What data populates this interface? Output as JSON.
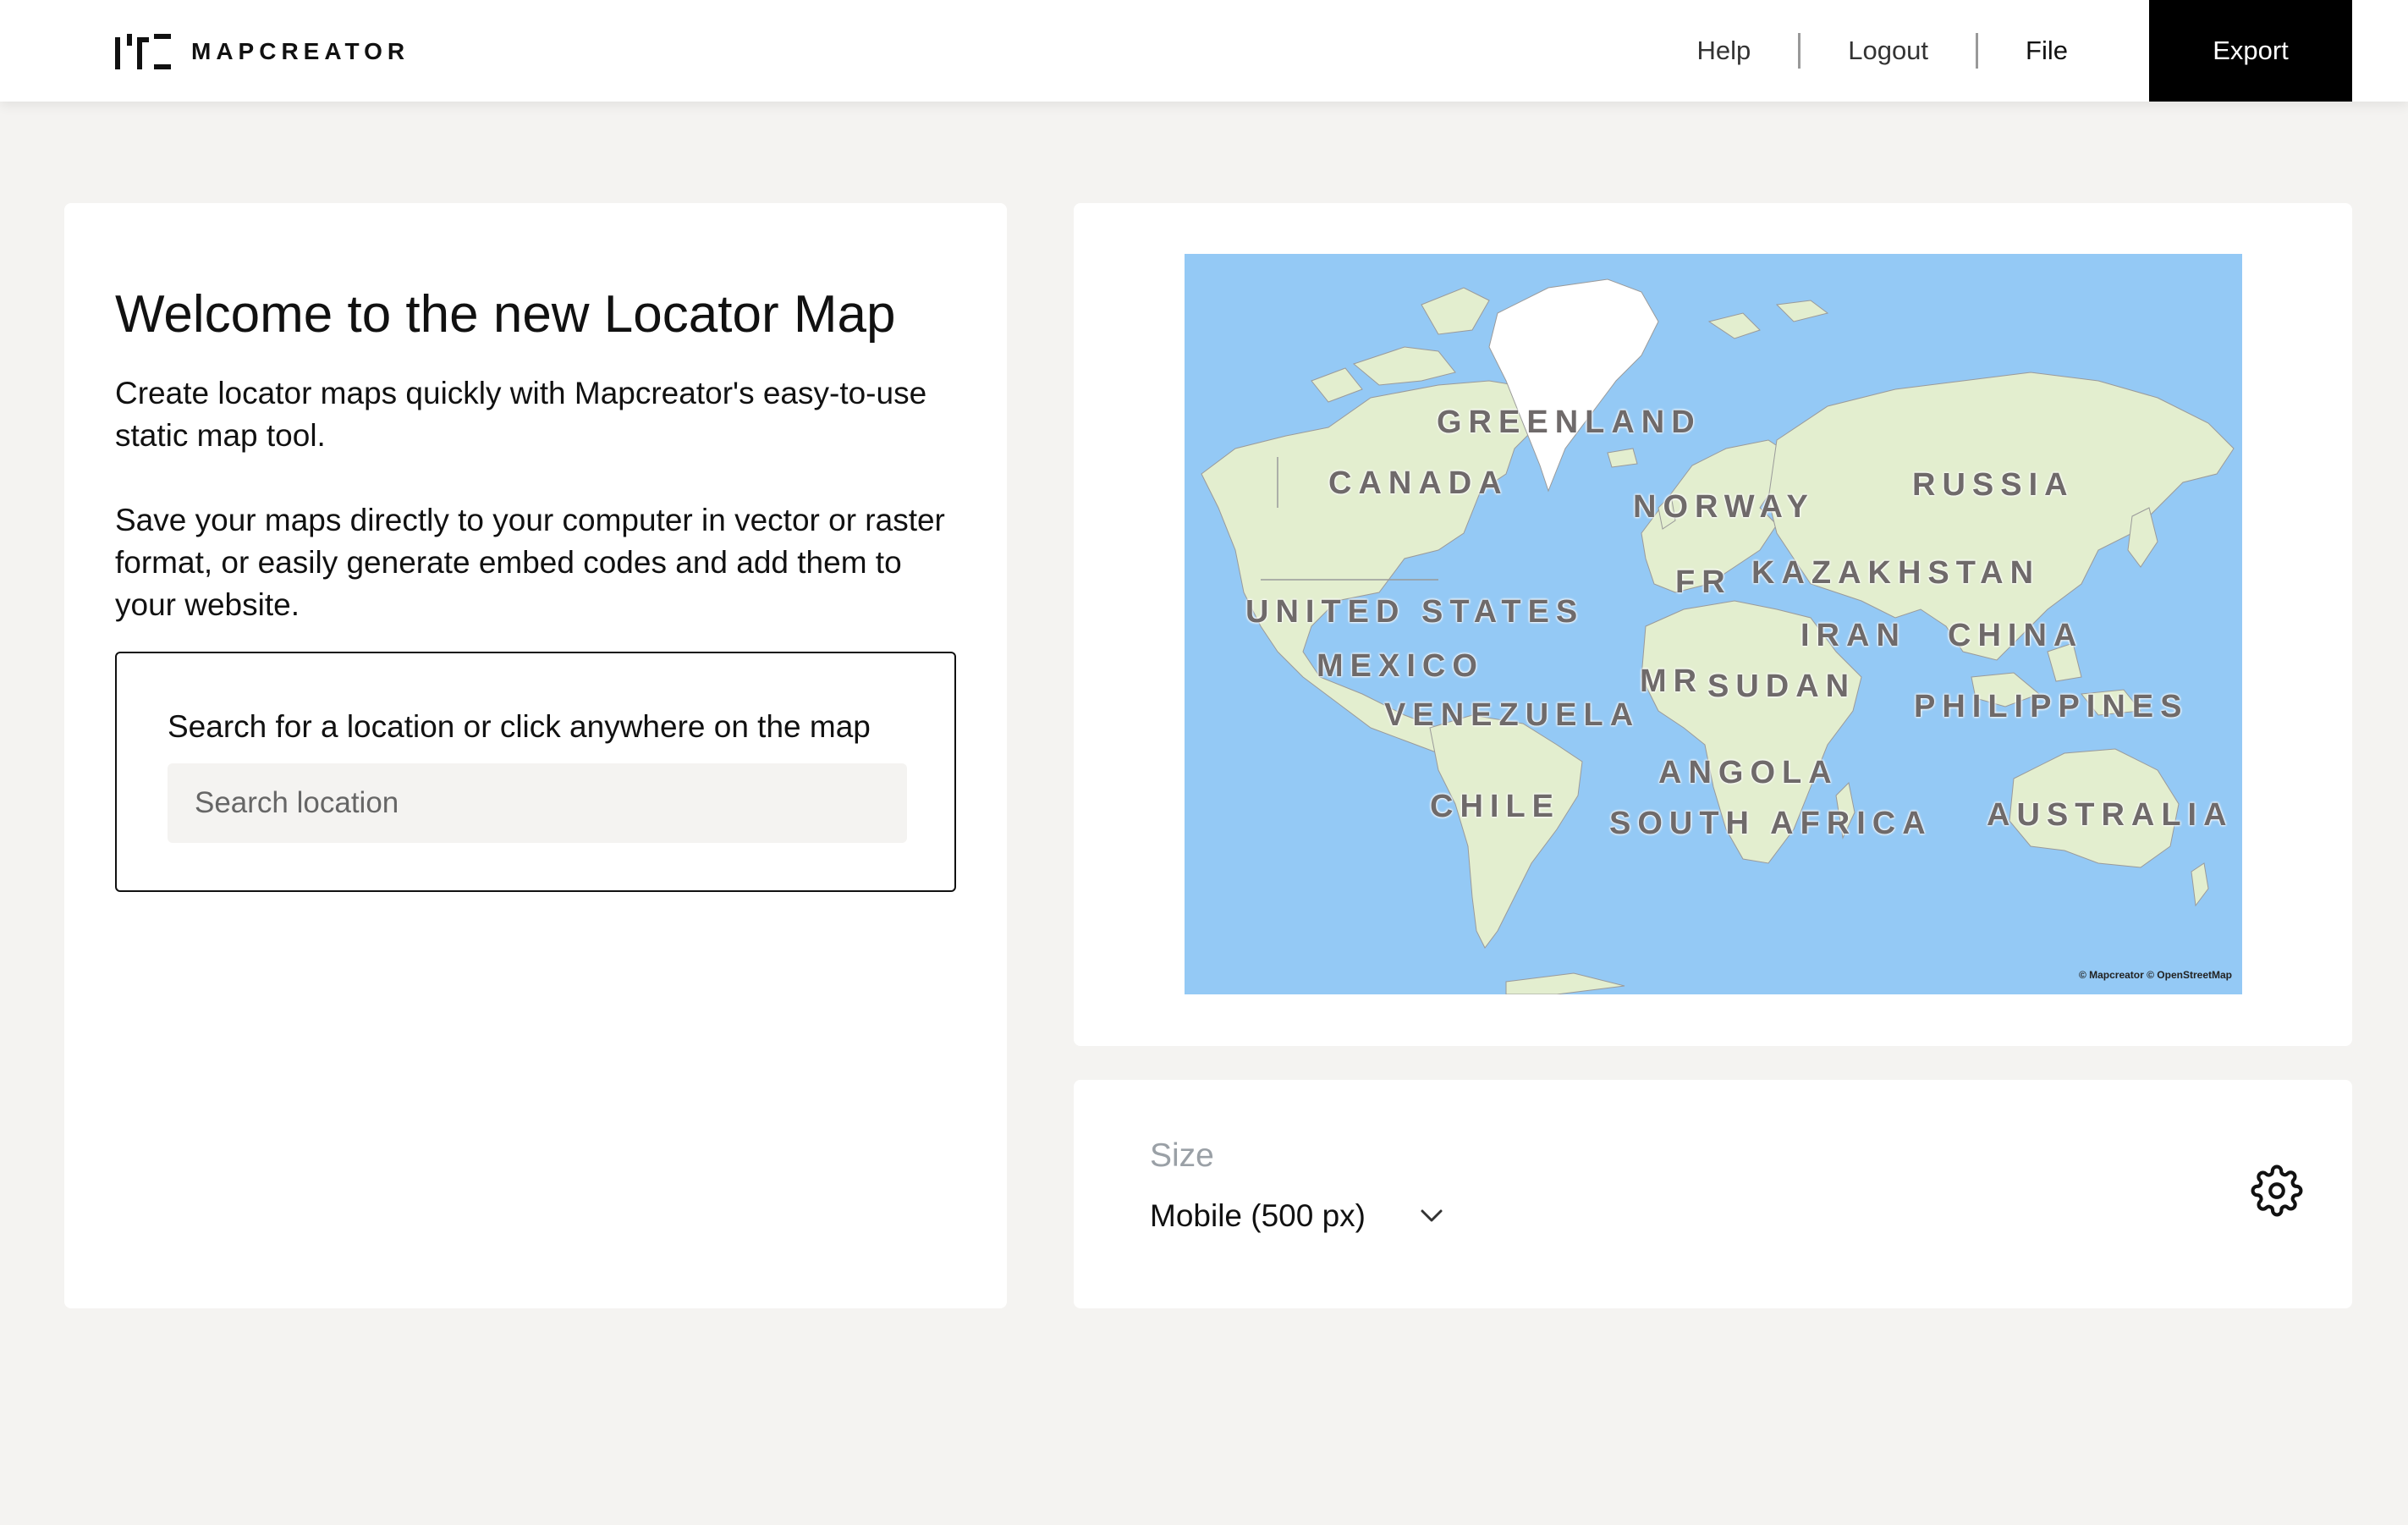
{
  "brand": {
    "name": "MAPCREATOR"
  },
  "nav": {
    "help": "Help",
    "logout": "Logout",
    "file": "File",
    "export": "Export"
  },
  "welcome": {
    "title": "Welcome to the new Locator Map",
    "p1": "Create locator maps quickly with Mapcreator's easy-to-use static map tool.",
    "p2": "Save your maps directly to your computer in vector or raster format, or easily generate embed codes and add them to your website."
  },
  "search": {
    "label": "Search for a location or click anywhere on the map",
    "placeholder": "Search location",
    "icon": "search-field"
  },
  "map": {
    "labels": {
      "greenland": "GREENLAND",
      "canada": "CANADA",
      "norway": "NORWAY",
      "russia": "RUSSIA",
      "fr": "FR",
      "kazakhstan": "KAZAKHSTAN",
      "united_states": "UNITED STATES",
      "iran": "IRAN",
      "china": "CHINA",
      "mexico": "MEXICO",
      "mr": "MR",
      "sudan": "SUDAN",
      "venezuela": "VENEZUELA",
      "philippines": "PHILIPPINES",
      "angola": "ANGOLA",
      "chile": "CHILE",
      "south_africa": "SOUTH AFRICA",
      "australia": "AUSTRALIA"
    },
    "attribution": "© Mapcreator © OpenStreetMap",
    "colors": {
      "water": "#94c9f5",
      "land": "#e4efcf",
      "ice": "#ffffff"
    }
  },
  "size": {
    "label": "Size",
    "value": "Mobile (500 px)",
    "icons": [
      "chevron-down-icon",
      "gear-icon"
    ]
  }
}
